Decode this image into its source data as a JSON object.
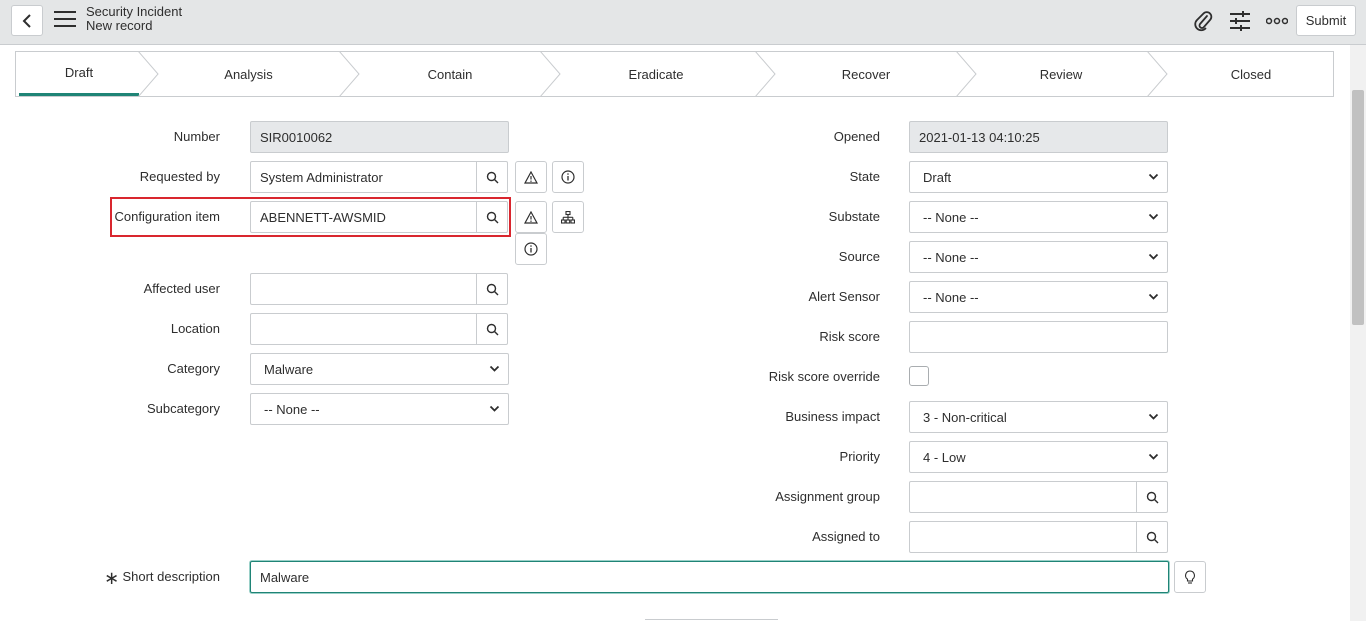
{
  "header": {
    "title": "Security Incident",
    "subtitle": "New record",
    "submit_label": "Submit",
    "icons": [
      "back-icon",
      "hamburger-menu-icon",
      "paperclip-icon",
      "sliders-icon",
      "more-options-icon"
    ]
  },
  "process_flow": {
    "stages": [
      {
        "label": "Draft",
        "active": true
      },
      {
        "label": "Analysis",
        "active": false
      },
      {
        "label": "Contain",
        "active": false
      },
      {
        "label": "Eradicate",
        "active": false
      },
      {
        "label": "Recover",
        "active": false
      },
      {
        "label": "Review",
        "active": false
      },
      {
        "label": "Closed",
        "active": false
      }
    ],
    "accent_color": "#1f8476"
  },
  "left_form": {
    "number": {
      "label": "Number",
      "value": "SIR0010062"
    },
    "requested_by": {
      "label": "Requested by",
      "value": "System Administrator"
    },
    "configuration_item": {
      "label": "Configuration item",
      "value": "ABENNETT-AWSMID"
    },
    "affected_user": {
      "label": "Affected user",
      "value": ""
    },
    "location": {
      "label": "Location",
      "value": ""
    },
    "category": {
      "label": "Category",
      "value": "Malware"
    },
    "subcategory": {
      "label": "Subcategory",
      "value": "-- None --"
    }
  },
  "right_form": {
    "opened": {
      "label": "Opened",
      "value": "2021-01-13 04:10:25"
    },
    "state": {
      "label": "State",
      "value": "Draft"
    },
    "substate": {
      "label": "Substate",
      "value": "-- None --"
    },
    "source": {
      "label": "Source",
      "value": "-- None --"
    },
    "alert_sensor": {
      "label": "Alert Sensor",
      "value": "-- None --"
    },
    "risk_score": {
      "label": "Risk score",
      "value": ""
    },
    "risk_score_override": {
      "label": "Risk score override",
      "checked": false
    },
    "business_impact": {
      "label": "Business impact",
      "value": "3 - Non-critical"
    },
    "priority": {
      "label": "Priority",
      "value": "4 - Low"
    },
    "assignment_group": {
      "label": "Assignment group",
      "value": ""
    },
    "assigned_to": {
      "label": "Assigned to",
      "value": ""
    }
  },
  "short_description": {
    "label": "Short description",
    "value": "Malware",
    "mandatory_marker": "∗"
  },
  "colors": {
    "highlight": "#d9262e",
    "readonly_bg": "#e6e8ea",
    "header_bg": "#e4e6e7"
  }
}
